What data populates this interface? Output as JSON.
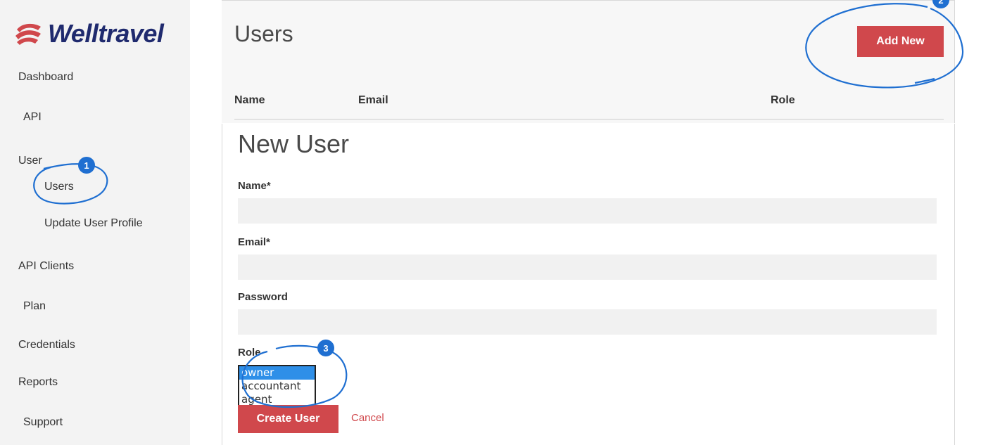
{
  "brand": {
    "name": "Welltravel",
    "accent": "#d0484c",
    "logo_color": "#1f2a6e"
  },
  "sidebar": {
    "items": [
      {
        "label": "Dashboard"
      },
      {
        "label": "API"
      },
      {
        "label": "User"
      },
      {
        "label": "Users"
      },
      {
        "label": "Update User Profile"
      },
      {
        "label": "API Clients"
      },
      {
        "label": "Plan"
      },
      {
        "label": "Credentials"
      },
      {
        "label": "Reports"
      },
      {
        "label": "Support"
      }
    ]
  },
  "header": {
    "title": "Users",
    "add_label": "Add New"
  },
  "table": {
    "columns": [
      "Name",
      "Email",
      "Role"
    ]
  },
  "form": {
    "title": "New User",
    "name_label": "Name*",
    "name_value": "",
    "email_label": "Email*",
    "email_value": "",
    "password_label": "Password",
    "password_value": "",
    "role_label": "Role",
    "role_options": [
      "owner",
      "accountant",
      "agent"
    ],
    "role_selected": "owner",
    "create_label": "Create User",
    "cancel_label": "Cancel"
  },
  "annotations": {
    "color": "#1f6fd1",
    "badges": [
      "1",
      "2",
      "3"
    ]
  }
}
